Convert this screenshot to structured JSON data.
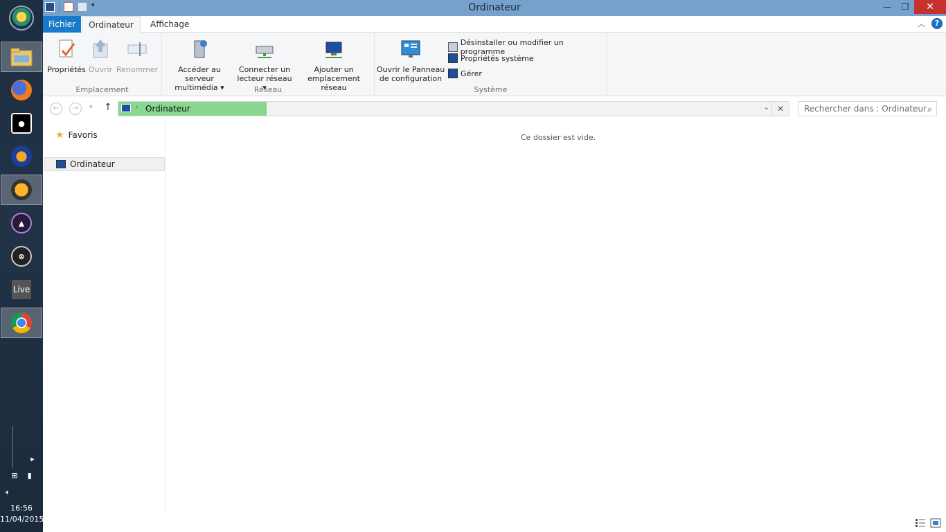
{
  "window": {
    "title": "Ordinateur"
  },
  "tabs": {
    "file": "Fichier",
    "computer": "Ordinateur",
    "view": "Affichage"
  },
  "ribbon": {
    "groups": {
      "location": "Emplacement",
      "network": "Réseau",
      "system": "Système"
    },
    "buttons": {
      "properties": "Propriétés",
      "open": "Ouvrir",
      "rename": "Renommer",
      "media_line1": "Accéder au serveur",
      "media_line2": "multimédia",
      "netdrive_line1": "Connecter un",
      "netdrive_line2": "lecteur réseau",
      "netloc_line1": "Ajouter un",
      "netloc_line2": "emplacement réseau",
      "panel_line1": "Ouvrir le Panneau",
      "panel_line2": "de configuration",
      "uninstall": "Désinstaller ou modifier un programme",
      "sysprops": "Propriétés système",
      "manage": "Gérer"
    }
  },
  "address": {
    "path": "Ordinateur",
    "search_placeholder": "Rechercher dans : Ordinateur"
  },
  "navpane": {
    "favorites": "Favoris",
    "computer": "Ordinateur"
  },
  "content": {
    "empty_message": "Ce dossier est vide."
  },
  "tray": {
    "time": "16:56",
    "date": "11/04/2015"
  },
  "taskbar": {
    "live_label": "Live"
  },
  "colors": {
    "title_bar": "#76a1cc",
    "file_tab": "#1979ca",
    "close_button": "#c7312d",
    "address_progress": "#88d78e"
  }
}
